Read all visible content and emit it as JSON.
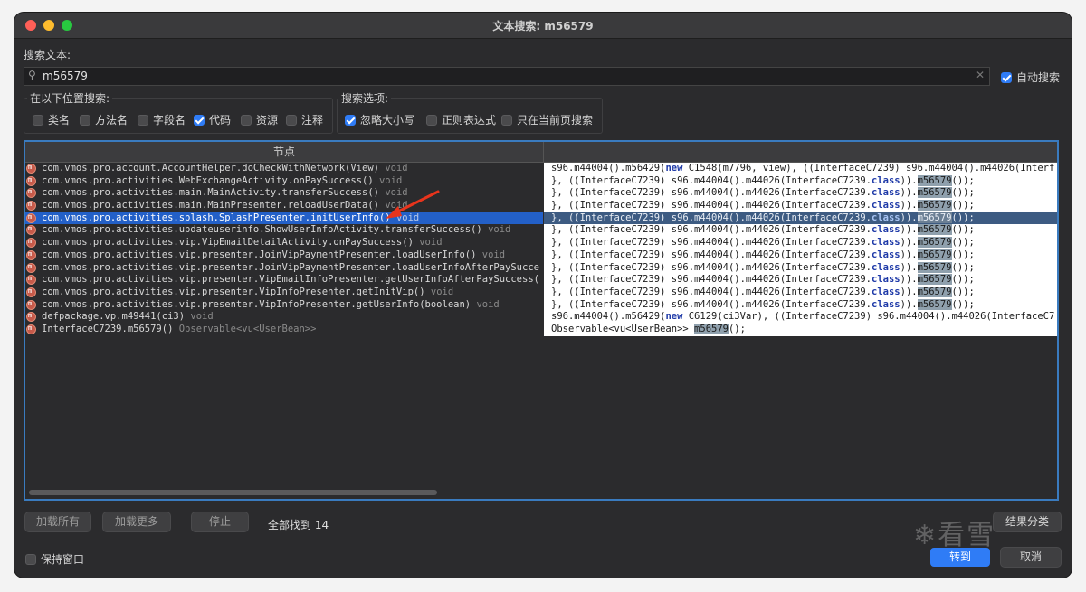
{
  "window": {
    "title": "文本搜索: m56579"
  },
  "search": {
    "label": "搜索文本:",
    "value": "m56579",
    "auto_search_label": "自动搜索",
    "auto_search_checked": true
  },
  "scope": {
    "title": "在以下位置搜索:",
    "options": [
      {
        "label": "类名",
        "checked": false
      },
      {
        "label": "方法名",
        "checked": false
      },
      {
        "label": "字段名",
        "checked": false
      },
      {
        "label": "代码",
        "checked": true
      },
      {
        "label": "资源",
        "checked": false
      },
      {
        "label": "注释",
        "checked": false
      }
    ]
  },
  "search_options": {
    "title": "搜索选项:",
    "options": [
      {
        "label": "忽略大小写",
        "checked": true
      },
      {
        "label": "正则表达式",
        "checked": false
      },
      {
        "label": "只在当前页搜索",
        "checked": false
      }
    ]
  },
  "results": {
    "column_header": "节点",
    "rows": [
      {
        "node": "com.vmos.pro.account.AccountHelper.doCheckWithNetwork(View)",
        "ret": "void"
      },
      {
        "node": "com.vmos.pro.activities.WebExchangeActivity.onPaySuccess()",
        "ret": "void"
      },
      {
        "node": "com.vmos.pro.activities.main.MainActivity.transferSuccess()",
        "ret": "void"
      },
      {
        "node": "com.vmos.pro.activities.main.MainPresenter.reloadUserData()",
        "ret": "void"
      },
      {
        "node": "com.vmos.pro.activities.splash.SplashPresenter.initUserInfo()",
        "ret": "void",
        "selected": true
      },
      {
        "node": "com.vmos.pro.activities.updateuserinfo.ShowUserInfoActivity.transferSuccess()",
        "ret": "void"
      },
      {
        "node": "com.vmos.pro.activities.vip.VipEmailDetailActivity.onPaySuccess()",
        "ret": "void"
      },
      {
        "node": "com.vmos.pro.activities.vip.presenter.JoinVipPaymentPresenter.loadUserInfo()",
        "ret": "void"
      },
      {
        "node": "com.vmos.pro.activities.vip.presenter.JoinVipPaymentPresenter.loadUserInfoAfterPaySucce",
        "ret": ""
      },
      {
        "node": "com.vmos.pro.activities.vip.presenter.VipEmailInfoPresenter.getUserInfoAfterPaySuccess(",
        "ret": ""
      },
      {
        "node": "com.vmos.pro.activities.vip.presenter.VipInfoPresenter.getInitVip()",
        "ret": "void"
      },
      {
        "node": "com.vmos.pro.activities.vip.presenter.VipInfoPresenter.getUserInfo(boolean)",
        "ret": "void"
      },
      {
        "node": "defpackage.vp.m49441(ci3)",
        "ret": "void"
      },
      {
        "node": "InterfaceC7239.m56579()",
        "ret": "Observable<vu<UserBean>>"
      }
    ],
    "code_lines": [
      {
        "a": "s96.m44004().m56429(",
        "kw": "new",
        "b": " C1548(m7796, view), ((InterfaceC7239) s96.m44004().m44026(Interf",
        "k2": "",
        "hl": "",
        "c": ""
      },
      {
        "a": "}, ((InterfaceC7239) s96.m44004().m44026(InterfaceC7239.",
        "kw": "class",
        "b": ")).",
        "hl": "m56579",
        "c": "());"
      },
      {
        "a": "}, ((InterfaceC7239) s96.m44004().m44026(InterfaceC7239.",
        "kw": "class",
        "b": ")).",
        "hl": "m56579",
        "c": "());"
      },
      {
        "a": "}, ((InterfaceC7239) s96.m44004().m44026(InterfaceC7239.",
        "kw": "class",
        "b": ")).",
        "hl": "m56579",
        "c": "());"
      },
      {
        "a": "}, ((InterfaceC7239) s96.m44004().m44026(InterfaceC7239.",
        "kw": "class",
        "b": ")).",
        "hl": "m56579",
        "c": "());",
        "selected": true
      },
      {
        "a": "}, ((InterfaceC7239) s96.m44004().m44026(InterfaceC7239.",
        "kw": "class",
        "b": ")).",
        "hl": "m56579",
        "c": "());"
      },
      {
        "a": "}, ((InterfaceC7239) s96.m44004().m44026(InterfaceC7239.",
        "kw": "class",
        "b": ")).",
        "hl": "m56579",
        "c": "());"
      },
      {
        "a": "}, ((InterfaceC7239) s96.m44004().m44026(InterfaceC7239.",
        "kw": "class",
        "b": ")).",
        "hl": "m56579",
        "c": "());"
      },
      {
        "a": "}, ((InterfaceC7239) s96.m44004().m44026(InterfaceC7239.",
        "kw": "class",
        "b": ")).",
        "hl": "m56579",
        "c": "());"
      },
      {
        "a": "}, ((InterfaceC7239) s96.m44004().m44026(InterfaceC7239.",
        "kw": "class",
        "b": ")).",
        "hl": "m56579",
        "c": "());"
      },
      {
        "a": "}, ((InterfaceC7239) s96.m44004().m44026(InterfaceC7239.",
        "kw": "class",
        "b": ")).",
        "hl": "m56579",
        "c": "());"
      },
      {
        "a": "}, ((InterfaceC7239) s96.m44004().m44026(InterfaceC7239.",
        "kw": "class",
        "b": ")).",
        "hl": "m56579",
        "c": "());"
      },
      {
        "a": "s96.m44004().m56429(",
        "kw": "new",
        "b": " C6129(ci3Var), ((InterfaceC7239) s96.m44004().m44026(InterfaceC7",
        "hl": "",
        "c": ""
      },
      {
        "a": "Observable<vu<UserBean>> ",
        "kw": "",
        "b": "",
        "hl": "m56579",
        "c": "();"
      }
    ]
  },
  "footer": {
    "load_all": "加载所有",
    "load_more": "加载更多",
    "stop": "停止",
    "status": "全部找到  14",
    "group_results": "结果分类",
    "keep_window": "保持窗口",
    "goto": "转到",
    "cancel": "取消",
    "watermark": "看雪"
  }
}
